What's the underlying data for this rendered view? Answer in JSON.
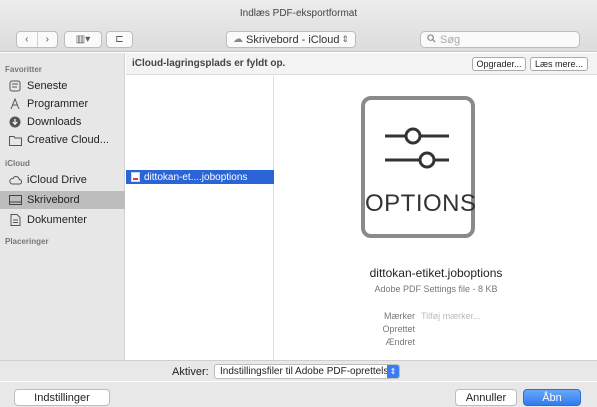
{
  "window": {
    "title": "Indlæs PDF-eksportformat"
  },
  "toolbar": {
    "back": "‹",
    "forward": "›",
    "view_icon": "▥▾",
    "folder_icon": "⊏",
    "location": "Skrivebord - iCloud",
    "location_arrows": "⇕",
    "search_placeholder": "Søg"
  },
  "sidebar": {
    "favorites_header": "Favoritter",
    "favorites": [
      {
        "label": "Seneste",
        "icon": "clock-icon"
      },
      {
        "label": "Programmer",
        "icon": "apps-icon"
      },
      {
        "label": "Downloads",
        "icon": "download-icon"
      },
      {
        "label": "Creative Cloud...",
        "icon": "folder-icon"
      }
    ],
    "icloud_header": "iCloud",
    "icloud": [
      {
        "label": "iCloud Drive",
        "icon": "cloud-icon"
      },
      {
        "label": "Skrivebord",
        "icon": "desktop-icon",
        "selected": true
      },
      {
        "label": "Dokumenter",
        "icon": "document-icon"
      }
    ],
    "locations_header": "Placeringer"
  },
  "infobar": {
    "message": "iCloud-lagringsplads er fyldt op.",
    "upgrade": "Opgrader...",
    "read_more": "Læs mere..."
  },
  "files": [
    {
      "name": "dittokan-et....joboptions",
      "selected": true
    }
  ],
  "preview": {
    "icon_text": "OPTIONS",
    "filename": "dittokan-etiket.joboptions",
    "kind": "Adobe PDF Settings file - 8 KB",
    "tags_label": "Mærker",
    "tags_placeholder": "Tilføj mærker...",
    "created_label": "Oprettet",
    "modified_label": "Ændret"
  },
  "activate": {
    "label": "Aktiver:",
    "value": "Indstillingsfiler til Adobe PDF-oprettelse (*.jo...",
    "arrows": "⇕"
  },
  "footer": {
    "settings": "Indstillinger",
    "cancel": "Annuller",
    "open": "Åbn"
  },
  "colors": {
    "selection": "#2a64d6",
    "primary_button": "#2f7cf0",
    "sidebar_bg": "#e7e7e7"
  }
}
